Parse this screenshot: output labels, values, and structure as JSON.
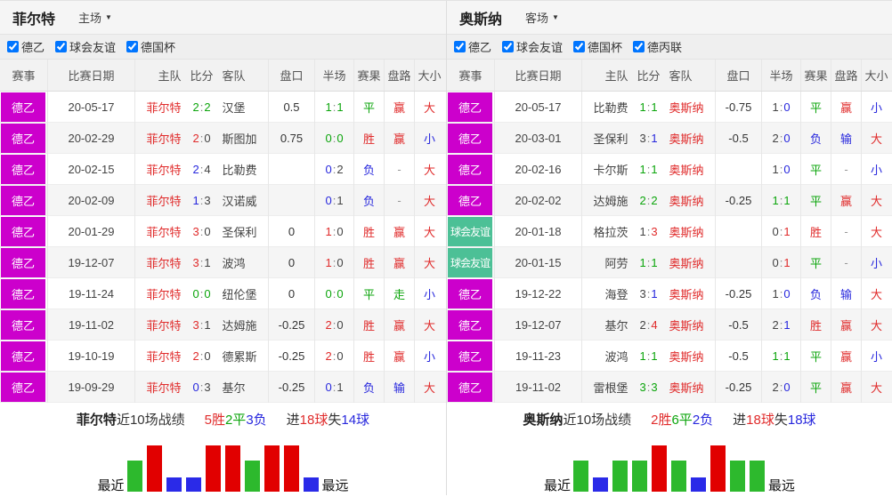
{
  "colors": {
    "win": "#e02b2b",
    "draw": "#0ca50c",
    "loss": "#2727dd",
    "neutral": "#444444",
    "dash": "#999999",
    "text": "#333333",
    "badge_league_bg": "#cc00cc",
    "badge_friendly_bg": "#4cc096"
  },
  "bar_styles": {
    "win": {
      "face": "#e10000",
      "top": "#ff5a5a",
      "side": "#a80000",
      "height": 52
    },
    "draw": {
      "face": "#2db92d",
      "top": "#72e072",
      "side": "#1e8a1e",
      "height": 35
    },
    "loss": {
      "face": "#2a2ae8",
      "top": "#7878ff",
      "side": "#1b1ba8",
      "height": 16
    }
  },
  "panels": [
    {
      "team": "菲尔特",
      "venue": "主场",
      "focal_side": "home",
      "filters": [
        "德乙",
        "球会友谊",
        "德国杯"
      ],
      "columns": {
        "league": "赛事",
        "date": "比赛日期",
        "home": "主队",
        "score": "比分",
        "away": "客队",
        "handicap": "盘口",
        "halftime": "半场",
        "result": "赛果",
        "handicap_result": "盘路",
        "overunder": "大小"
      },
      "rows": [
        {
          "league": "德乙",
          "league_kind": "league",
          "date": "20-05-17",
          "home": "菲尔特",
          "away": "汉堡",
          "ft": {
            "h": "2",
            "a": "2",
            "hc": "draw",
            "ac": "draw"
          },
          "handicap": "0.5",
          "ht": {
            "h": "1",
            "a": "1",
            "hc": "draw",
            "ac": "draw"
          },
          "result": {
            "text": "平",
            "color": "draw"
          },
          "handicap_result": {
            "text": "赢",
            "color": "win"
          },
          "overunder": {
            "text": "大",
            "color": "win"
          }
        },
        {
          "league": "德乙",
          "league_kind": "league",
          "date": "20-02-29",
          "home": "菲尔特",
          "away": "斯图加",
          "ft": {
            "h": "2",
            "a": "0",
            "hc": "win",
            "ac": "neutral"
          },
          "handicap": "0.75",
          "ht": {
            "h": "0",
            "a": "0",
            "hc": "draw",
            "ac": "draw"
          },
          "result": {
            "text": "胜",
            "color": "win"
          },
          "handicap_result": {
            "text": "赢",
            "color": "win"
          },
          "overunder": {
            "text": "小",
            "color": "loss"
          }
        },
        {
          "league": "德乙",
          "league_kind": "league",
          "date": "20-02-15",
          "home": "菲尔特",
          "away": "比勒费",
          "ft": {
            "h": "2",
            "a": "4",
            "hc": "loss",
            "ac": "neutral"
          },
          "handicap": "",
          "ht": {
            "h": "0",
            "a": "2",
            "hc": "loss",
            "ac": "neutral"
          },
          "result": {
            "text": "负",
            "color": "loss"
          },
          "handicap_result": {
            "text": "-",
            "color": "dash"
          },
          "overunder": {
            "text": "大",
            "color": "win"
          }
        },
        {
          "league": "德乙",
          "league_kind": "league",
          "date": "20-02-09",
          "home": "菲尔特",
          "away": "汉诺威",
          "ft": {
            "h": "1",
            "a": "3",
            "hc": "loss",
            "ac": "neutral"
          },
          "handicap": "",
          "ht": {
            "h": "0",
            "a": "1",
            "hc": "loss",
            "ac": "neutral"
          },
          "result": {
            "text": "负",
            "color": "loss"
          },
          "handicap_result": {
            "text": "-",
            "color": "dash"
          },
          "overunder": {
            "text": "大",
            "color": "win"
          }
        },
        {
          "league": "德乙",
          "league_kind": "league",
          "date": "20-01-29",
          "home": "菲尔特",
          "away": "圣保利",
          "ft": {
            "h": "3",
            "a": "0",
            "hc": "win",
            "ac": "neutral"
          },
          "handicap": "0",
          "ht": {
            "h": "1",
            "a": "0",
            "hc": "win",
            "ac": "neutral"
          },
          "result": {
            "text": "胜",
            "color": "win"
          },
          "handicap_result": {
            "text": "赢",
            "color": "win"
          },
          "overunder": {
            "text": "大",
            "color": "win"
          }
        },
        {
          "league": "德乙",
          "league_kind": "league",
          "date": "19-12-07",
          "home": "菲尔特",
          "away": "波鸿",
          "ft": {
            "h": "3",
            "a": "1",
            "hc": "win",
            "ac": "neutral"
          },
          "handicap": "0",
          "ht": {
            "h": "1",
            "a": "0",
            "hc": "win",
            "ac": "neutral"
          },
          "result": {
            "text": "胜",
            "color": "win"
          },
          "handicap_result": {
            "text": "赢",
            "color": "win"
          },
          "overunder": {
            "text": "大",
            "color": "win"
          }
        },
        {
          "league": "德乙",
          "league_kind": "league",
          "date": "19-11-24",
          "home": "菲尔特",
          "away": "纽伦堡",
          "ft": {
            "h": "0",
            "a": "0",
            "hc": "draw",
            "ac": "draw"
          },
          "handicap": "0",
          "ht": {
            "h": "0",
            "a": "0",
            "hc": "draw",
            "ac": "draw"
          },
          "result": {
            "text": "平",
            "color": "draw"
          },
          "handicap_result": {
            "text": "走",
            "color": "draw"
          },
          "overunder": {
            "text": "小",
            "color": "loss"
          }
        },
        {
          "league": "德乙",
          "league_kind": "league",
          "date": "19-11-02",
          "home": "菲尔特",
          "away": "达姆施",
          "ft": {
            "h": "3",
            "a": "1",
            "hc": "win",
            "ac": "neutral"
          },
          "handicap": "-0.25",
          "ht": {
            "h": "2",
            "a": "0",
            "hc": "win",
            "ac": "neutral"
          },
          "result": {
            "text": "胜",
            "color": "win"
          },
          "handicap_result": {
            "text": "赢",
            "color": "win"
          },
          "overunder": {
            "text": "大",
            "color": "win"
          }
        },
        {
          "league": "德乙",
          "league_kind": "league",
          "date": "19-10-19",
          "home": "菲尔特",
          "away": "德累斯",
          "ft": {
            "h": "2",
            "a": "0",
            "hc": "win",
            "ac": "neutral"
          },
          "handicap": "-0.25",
          "ht": {
            "h": "2",
            "a": "0",
            "hc": "win",
            "ac": "neutral"
          },
          "result": {
            "text": "胜",
            "color": "win"
          },
          "handicap_result": {
            "text": "赢",
            "color": "win"
          },
          "overunder": {
            "text": "小",
            "color": "loss"
          }
        },
        {
          "league": "德乙",
          "league_kind": "league",
          "date": "19-09-29",
          "home": "菲尔特",
          "away": "基尔",
          "ft": {
            "h": "0",
            "a": "3",
            "hc": "loss",
            "ac": "neutral"
          },
          "handicap": "-0.25",
          "ht": {
            "h": "0",
            "a": "1",
            "hc": "loss",
            "ac": "neutral"
          },
          "result": {
            "text": "负",
            "color": "loss"
          },
          "handicap_result": {
            "text": "输",
            "color": "loss"
          },
          "overunder": {
            "text": "大",
            "color": "win"
          }
        }
      ],
      "summary": {
        "team": "菲尔特",
        "label_suffix": "近10场战绩",
        "record": [
          {
            "text": "5胜",
            "color": "win"
          },
          {
            "text": "2平",
            "color": "draw"
          },
          {
            "text": "3负",
            "color": "loss"
          }
        ],
        "goals": [
          {
            "text": "进",
            "color": "text"
          },
          {
            "text": "18球",
            "color": "win"
          },
          {
            "text": "失",
            "color": "text"
          },
          {
            "text": "14球",
            "color": "loss"
          }
        ]
      },
      "chart": {
        "near_label": "最近",
        "far_label": "最远",
        "results": [
          "draw",
          "win",
          "loss",
          "loss",
          "win",
          "win",
          "draw",
          "win",
          "win",
          "loss"
        ]
      }
    },
    {
      "team": "奥斯纳",
      "venue": "客场",
      "focal_side": "away",
      "filters": [
        "德乙",
        "球会友谊",
        "德国杯",
        "德丙联"
      ],
      "columns": {
        "league": "赛事",
        "date": "比赛日期",
        "home": "主队",
        "score": "比分",
        "away": "客队",
        "handicap": "盘口",
        "halftime": "半场",
        "result": "赛果",
        "handicap_result": "盘路",
        "overunder": "大小"
      },
      "rows": [
        {
          "league": "德乙",
          "league_kind": "league",
          "date": "20-05-17",
          "home": "比勒费",
          "away": "奥斯纳",
          "ft": {
            "h": "1",
            "a": "1",
            "hc": "draw",
            "ac": "draw"
          },
          "handicap": "-0.75",
          "ht": {
            "h": "1",
            "a": "0",
            "hc": "neutral",
            "ac": "loss"
          },
          "result": {
            "text": "平",
            "color": "draw"
          },
          "handicap_result": {
            "text": "赢",
            "color": "win"
          },
          "overunder": {
            "text": "小",
            "color": "loss"
          }
        },
        {
          "league": "德乙",
          "league_kind": "league",
          "date": "20-03-01",
          "home": "圣保利",
          "away": "奥斯纳",
          "ft": {
            "h": "3",
            "a": "1",
            "hc": "neutral",
            "ac": "loss"
          },
          "handicap": "-0.5",
          "ht": {
            "h": "2",
            "a": "0",
            "hc": "neutral",
            "ac": "loss"
          },
          "result": {
            "text": "负",
            "color": "loss"
          },
          "handicap_result": {
            "text": "输",
            "color": "loss"
          },
          "overunder": {
            "text": "大",
            "color": "win"
          }
        },
        {
          "league": "德乙",
          "league_kind": "league",
          "date": "20-02-16",
          "home": "卡尔斯",
          "away": "奥斯纳",
          "ft": {
            "h": "1",
            "a": "1",
            "hc": "draw",
            "ac": "draw"
          },
          "handicap": "",
          "ht": {
            "h": "1",
            "a": "0",
            "hc": "neutral",
            "ac": "loss"
          },
          "result": {
            "text": "平",
            "color": "draw"
          },
          "handicap_result": {
            "text": "-",
            "color": "dash"
          },
          "overunder": {
            "text": "小",
            "color": "loss"
          }
        },
        {
          "league": "德乙",
          "league_kind": "league",
          "date": "20-02-02",
          "home": "达姆施",
          "away": "奥斯纳",
          "ft": {
            "h": "2",
            "a": "2",
            "hc": "draw",
            "ac": "draw"
          },
          "handicap": "-0.25",
          "ht": {
            "h": "1",
            "a": "1",
            "hc": "draw",
            "ac": "draw"
          },
          "result": {
            "text": "平",
            "color": "draw"
          },
          "handicap_result": {
            "text": "赢",
            "color": "win"
          },
          "overunder": {
            "text": "大",
            "color": "win"
          }
        },
        {
          "league": "球会友谊",
          "league_kind": "friendly",
          "date": "20-01-18",
          "home": "格拉茨",
          "away": "奥斯纳",
          "ft": {
            "h": "1",
            "a": "3",
            "hc": "neutral",
            "ac": "win"
          },
          "handicap": "",
          "ht": {
            "h": "0",
            "a": "1",
            "hc": "neutral",
            "ac": "win"
          },
          "result": {
            "text": "胜",
            "color": "win"
          },
          "handicap_result": {
            "text": "-",
            "color": "dash"
          },
          "overunder": {
            "text": "大",
            "color": "win"
          }
        },
        {
          "league": "球会友谊",
          "league_kind": "friendly",
          "date": "20-01-15",
          "home": "阿劳",
          "away": "奥斯纳",
          "ft": {
            "h": "1",
            "a": "1",
            "hc": "draw",
            "ac": "draw"
          },
          "handicap": "",
          "ht": {
            "h": "0",
            "a": "1",
            "hc": "neutral",
            "ac": "win"
          },
          "result": {
            "text": "平",
            "color": "draw"
          },
          "handicap_result": {
            "text": "-",
            "color": "dash"
          },
          "overunder": {
            "text": "小",
            "color": "loss"
          }
        },
        {
          "league": "德乙",
          "league_kind": "league",
          "date": "19-12-22",
          "home": "海登",
          "away": "奥斯纳",
          "ft": {
            "h": "3",
            "a": "1",
            "hc": "neutral",
            "ac": "loss"
          },
          "handicap": "-0.25",
          "ht": {
            "h": "1",
            "a": "0",
            "hc": "neutral",
            "ac": "loss"
          },
          "result": {
            "text": "负",
            "color": "loss"
          },
          "handicap_result": {
            "text": "输",
            "color": "loss"
          },
          "overunder": {
            "text": "大",
            "color": "win"
          }
        },
        {
          "league": "德乙",
          "league_kind": "league",
          "date": "19-12-07",
          "home": "基尔",
          "away": "奥斯纳",
          "ft": {
            "h": "2",
            "a": "4",
            "hc": "neutral",
            "ac": "win"
          },
          "handicap": "-0.5",
          "ht": {
            "h": "2",
            "a": "1",
            "hc": "neutral",
            "ac": "loss"
          },
          "result": {
            "text": "胜",
            "color": "win"
          },
          "handicap_result": {
            "text": "赢",
            "color": "win"
          },
          "overunder": {
            "text": "大",
            "color": "win"
          }
        },
        {
          "league": "德乙",
          "league_kind": "league",
          "date": "19-11-23",
          "home": "波鸿",
          "away": "奥斯纳",
          "ft": {
            "h": "1",
            "a": "1",
            "hc": "draw",
            "ac": "draw"
          },
          "handicap": "-0.5",
          "ht": {
            "h": "1",
            "a": "1",
            "hc": "draw",
            "ac": "draw"
          },
          "result": {
            "text": "平",
            "color": "draw"
          },
          "handicap_result": {
            "text": "赢",
            "color": "win"
          },
          "overunder": {
            "text": "小",
            "color": "loss"
          }
        },
        {
          "league": "德乙",
          "league_kind": "league",
          "date": "19-11-02",
          "home": "雷根堡",
          "away": "奥斯纳",
          "ft": {
            "h": "3",
            "a": "3",
            "hc": "draw",
            "ac": "draw"
          },
          "handicap": "-0.25",
          "ht": {
            "h": "2",
            "a": "0",
            "hc": "neutral",
            "ac": "loss"
          },
          "result": {
            "text": "平",
            "color": "draw"
          },
          "handicap_result": {
            "text": "赢",
            "color": "win"
          },
          "overunder": {
            "text": "大",
            "color": "win"
          }
        }
      ],
      "summary": {
        "team": "奥斯纳",
        "label_suffix": "近10场战绩",
        "record": [
          {
            "text": "2胜",
            "color": "win"
          },
          {
            "text": "6平",
            "color": "draw"
          },
          {
            "text": "2负",
            "color": "loss"
          }
        ],
        "goals": [
          {
            "text": "进",
            "color": "text"
          },
          {
            "text": "18球",
            "color": "win"
          },
          {
            "text": "失",
            "color": "text"
          },
          {
            "text": "18球",
            "color": "loss"
          }
        ]
      },
      "chart": {
        "near_label": "最近",
        "far_label": "最远",
        "results": [
          "draw",
          "loss",
          "draw",
          "draw",
          "win",
          "draw",
          "loss",
          "win",
          "draw",
          "draw"
        ]
      }
    }
  ]
}
